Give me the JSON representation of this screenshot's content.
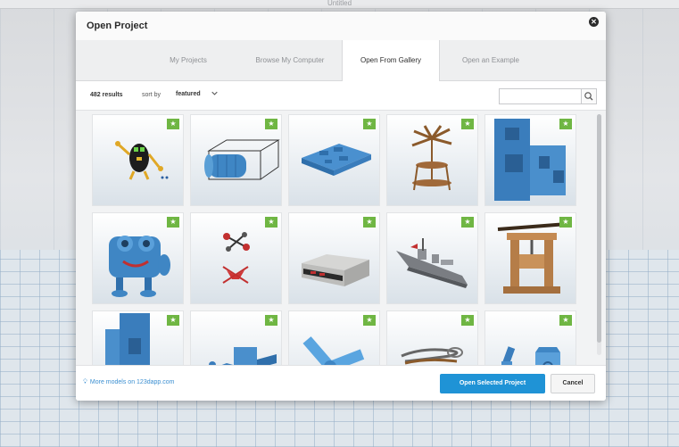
{
  "app": {
    "window_title": "Untitled"
  },
  "dialog": {
    "title": "Open Project",
    "close_glyph": "✕",
    "tabs": [
      {
        "label": "My Projects",
        "active": false
      },
      {
        "label": "Browse My Computer",
        "active": false
      },
      {
        "label": "Open From Gallery",
        "active": true
      },
      {
        "label": "Open an Example",
        "active": false
      }
    ],
    "results_label": "482 results",
    "sort_label": "sort by",
    "sort_value": "featured",
    "search": {
      "placeholder": "",
      "value": ""
    },
    "tiles": [
      {
        "model": "robot-character",
        "featured": true
      },
      {
        "model": "drum-cage-frame",
        "featured": true
      },
      {
        "model": "blue-tray",
        "featured": true
      },
      {
        "model": "wooden-windmill",
        "featured": true
      },
      {
        "model": "blue-block-assembly",
        "featured": true
      },
      {
        "model": "blue-creature",
        "featured": true
      },
      {
        "model": "mini-quadcopter",
        "featured": true
      },
      {
        "model": "retro-console",
        "featured": true
      },
      {
        "model": "battleship",
        "featured": true
      },
      {
        "model": "wooden-press",
        "featured": true
      },
      {
        "model": "blue-stand",
        "featured": true
      },
      {
        "model": "flat-parts",
        "featured": true
      },
      {
        "model": "bent-arm",
        "featured": true
      },
      {
        "model": "spring-clip",
        "featured": true
      },
      {
        "model": "blue-pieces",
        "featured": true
      }
    ],
    "footer": {
      "more_models_link": "More models on 123dapp.com",
      "open_button": "Open Selected Project",
      "cancel_button": "Cancel"
    }
  },
  "colors": {
    "accent_blue": "#1f93d6",
    "featured_green": "#6fb643",
    "link_blue": "#3b8fd1"
  }
}
